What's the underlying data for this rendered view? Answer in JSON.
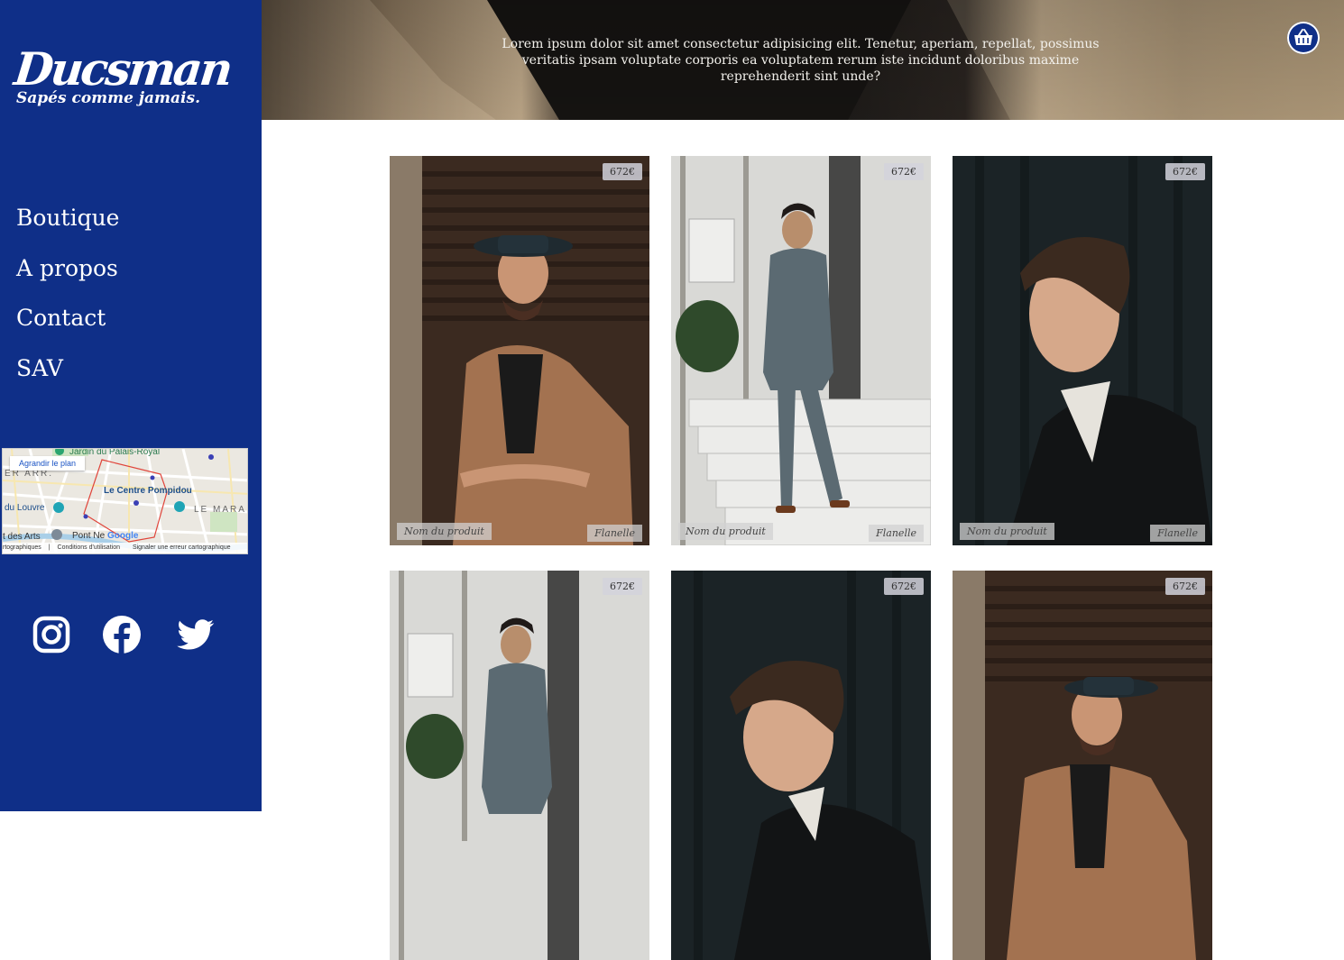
{
  "brand": {
    "name": "Ducsman",
    "tagline": "Sapés comme jamais."
  },
  "nav": {
    "items": [
      {
        "label": "Boutique"
      },
      {
        "label": "A propos"
      },
      {
        "label": "Contact"
      },
      {
        "label": "SAV"
      }
    ]
  },
  "map": {
    "enlarge_label": "Agrandir le plan",
    "labels": {
      "garden": "Jardin du Palais-Royal",
      "district": "ER ARR.",
      "center": "Le Centre Pompidou",
      "louvre": "du Louvre",
      "marais": "LE MARA",
      "arts": "t des Arts",
      "bridge": "Pont Ne",
      "google": "Google"
    },
    "footer": {
      "data": "rtographiques",
      "terms": "Conditions d'utilisation",
      "report": "Signaler une erreur cartographique"
    }
  },
  "social": {
    "icons": [
      "instagram-icon",
      "facebook-icon",
      "twitter-icon"
    ]
  },
  "hero": {
    "text": "Lorem ipsum dolor sit amet consectetur adipisicing elit. Tenetur, aperiam, repellat, possimus veritatis ipsam voluptate corporis ea voluptatem rerum iste incidunt doloribus maxime reprehenderit sint unde?"
  },
  "cart": {
    "icon": "basket-icon"
  },
  "products": [
    {
      "price": "672€",
      "name": "Nom du produit",
      "material": "Flanelle"
    },
    {
      "price": "672€",
      "name": "Nom du produit",
      "material": "Flanelle"
    },
    {
      "price": "672€",
      "name": "Nom du produit",
      "material": "Flanelle"
    },
    {
      "price": "672€"
    },
    {
      "price": "672€"
    },
    {
      "price": "672€"
    }
  ],
  "colors": {
    "sidebar": "#0f2f88",
    "text_light": "#ffffff"
  }
}
